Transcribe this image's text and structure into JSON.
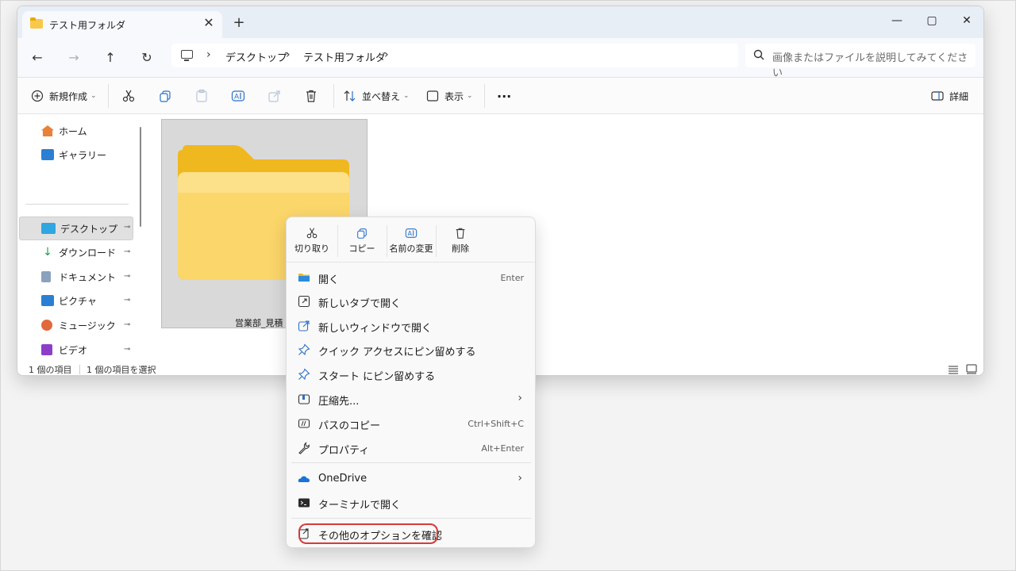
{
  "window": {
    "tab_title": "テスト用フォルダ",
    "tab_close": "✕",
    "new_tab": "+",
    "minimize": "—",
    "maximize": "▢",
    "close": "✕"
  },
  "navigation": {
    "back": "←",
    "forward": "→",
    "up": "↑",
    "refresh": "↻",
    "breadcrumb": [
      "デスクトップ",
      "テスト用フォルダ"
    ],
    "separator": "›",
    "search_placeholder": "画像またはファイルを説明してみてください"
  },
  "toolbar": {
    "new_label": "新規作成",
    "sort_label": "並べ替え",
    "view_label": "表示",
    "more": "···",
    "details_label": "詳細"
  },
  "sidebar": {
    "items": [
      {
        "label": "ホーム",
        "icon": "home-icon"
      },
      {
        "label": "ギャラリー",
        "icon": "gallery-icon"
      },
      {
        "label": "デスクトップ",
        "icon": "desktop-icon",
        "pinned": true,
        "selected": true
      },
      {
        "label": "ダウンロード",
        "icon": "download-icon",
        "pinned": true
      },
      {
        "label": "ドキュメント",
        "icon": "document-icon",
        "pinned": true
      },
      {
        "label": "ピクチャ",
        "icon": "pictures-icon",
        "pinned": true
      },
      {
        "label": "ミュージック",
        "icon": "music-icon",
        "pinned": true
      },
      {
        "label": "ビデオ",
        "icon": "video-icon",
        "pinned": true
      }
    ],
    "pin_glyph": "📌"
  },
  "content": {
    "file_label": "営業部_見積",
    "file_label_suffix": "ﾞ"
  },
  "status": {
    "item_count": "1 個の項目",
    "selected_count": "1 個の項目を選択"
  },
  "context_menu": {
    "quick_actions": [
      {
        "label": "切り取り",
        "icon": "cut-icon"
      },
      {
        "label": "コピー",
        "icon": "copy-icon"
      },
      {
        "label": "名前の変更",
        "icon": "rename-icon"
      },
      {
        "label": "削除",
        "icon": "delete-icon"
      }
    ],
    "items": [
      {
        "label": "開く",
        "shortcut": "Enter",
        "icon": "folder-icon"
      },
      {
        "label": "新しいタブで開く",
        "shortcut": "",
        "icon": "open-tab-icon"
      },
      {
        "label": "新しいウィンドウで開く",
        "shortcut": "",
        "icon": "open-window-icon"
      },
      {
        "label": "クイック アクセスにピン留めする",
        "shortcut": "",
        "icon": "pin-icon"
      },
      {
        "label": "スタート にピン留めする",
        "shortcut": "",
        "icon": "pin-icon"
      },
      {
        "label": "圧縮先...",
        "shortcut": "",
        "icon": "zip-icon",
        "submenu": true
      },
      {
        "label": "パスのコピー",
        "shortcut": "Ctrl+Shift+C",
        "icon": "copy-path-icon"
      },
      {
        "label": "プロパティ",
        "shortcut": "Alt+Enter",
        "icon": "wrench-icon"
      }
    ],
    "items2": [
      {
        "label": "OneDrive",
        "icon": "onedrive-icon",
        "submenu": true
      },
      {
        "label": "ターミナルで開く",
        "icon": "terminal-icon"
      }
    ],
    "more_options": "その他のオプションを確認",
    "chevron": "›"
  },
  "colors": {
    "accent_highlight": "#d63a3a",
    "folder_yellow": "#f7c948",
    "folder_dark": "#e9a800"
  }
}
